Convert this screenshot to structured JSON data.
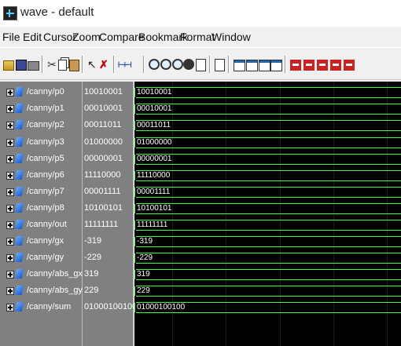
{
  "window": {
    "title": "wave - default"
  },
  "menu": [
    "File",
    "Edit",
    "Cursor",
    "Zoom",
    "Compare",
    "Bookmark",
    "Format",
    "Window"
  ],
  "toolbar": {
    "icons": [
      "open-icon",
      "save-icon",
      "print-icon",
      "cut-icon",
      "copy-icon",
      "paste-icon",
      "select-cursor-icon",
      "delete-icon",
      "insert-wave-icon",
      "zoom-in-icon",
      "zoom-out-icon",
      "zoom-full-icon",
      "zoom-cursor-icon",
      "zoom-last-icon",
      "doc-icon",
      "find-icon",
      "find-next-icon",
      "find-prev-icon",
      "edge-first-icon",
      "edge-prev-icon",
      "edge-next-icon",
      "edge-last-icon",
      "edge-marker-icon"
    ]
  },
  "signals": [
    {
      "name": "/canny/p0",
      "value": "10010001",
      "wave": "10010001"
    },
    {
      "name": "/canny/p1",
      "value": "00010001",
      "wave": "00010001"
    },
    {
      "name": "/canny/p2",
      "value": "00011011",
      "wave": "00011011"
    },
    {
      "name": "/canny/p3",
      "value": "01000000",
      "wave": "01000000"
    },
    {
      "name": "/canny/p5",
      "value": "00000001",
      "wave": "00000001"
    },
    {
      "name": "/canny/p6",
      "value": "11110000",
      "wave": "11110000"
    },
    {
      "name": "/canny/p7",
      "value": "00001111",
      "wave": "00001111"
    },
    {
      "name": "/canny/p8",
      "value": "10100101",
      "wave": "10100101"
    },
    {
      "name": "/canny/out",
      "value": "11111111",
      "wave": "11111111"
    },
    {
      "name": "/canny/gx",
      "value": "-319",
      "wave": "-319"
    },
    {
      "name": "/canny/gy",
      "value": "-229",
      "wave": "-229"
    },
    {
      "name": "/canny/abs_gx",
      "value": "319",
      "wave": "319"
    },
    {
      "name": "/canny/abs_gy",
      "value": "229",
      "wave": "229"
    },
    {
      "name": "/canny/sum",
      "value": "01000100100",
      "wave": "01000100100"
    }
  ],
  "colors": {
    "trace": "#3cff3c",
    "wave_bg": "#000000",
    "pane_bg": "#808080"
  }
}
